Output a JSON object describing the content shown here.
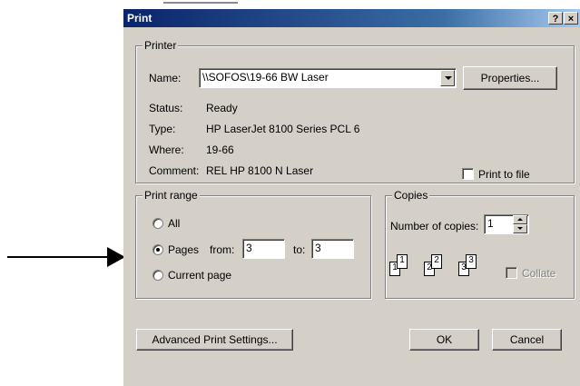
{
  "dialog": {
    "title": "Print",
    "help_button": "?",
    "close_button": "×"
  },
  "printer": {
    "group_label": "Printer",
    "name_label": "Name:",
    "name_value": "\\\\SOFOS\\19-66 BW Laser",
    "properties_button": "Properties...",
    "status_label": "Status:",
    "status_value": "Ready",
    "type_label": "Type:",
    "type_value": "HP LaserJet 8100 Series PCL 6",
    "where_label": "Where:",
    "where_value": "19-66",
    "comment_label": "Comment:",
    "comment_value": "REL HP 8100 N Laser",
    "print_to_file_label": "Print to file"
  },
  "print_range": {
    "group_label": "Print range",
    "all_label": "All",
    "pages_label": "Pages",
    "from_label": "from:",
    "from_value": "3",
    "to_label": "to:",
    "to_value": "3",
    "current_page_label": "Current page",
    "selected": "pages"
  },
  "copies": {
    "group_label": "Copies",
    "number_label": "Number of copies:",
    "number_value": "1",
    "collate_label": "Collate",
    "page_icons": [
      {
        "back": "1",
        "front": "1"
      },
      {
        "back": "2",
        "front": "2"
      },
      {
        "back": "3",
        "front": "3"
      }
    ]
  },
  "buttons": {
    "advanced": "Advanced Print Settings...",
    "ok": "OK",
    "cancel": "Cancel"
  },
  "colors": {
    "dialog_face": "#d4d0c8",
    "titlebar_start": "#0a246a",
    "titlebar_end": "#a6caf0"
  }
}
